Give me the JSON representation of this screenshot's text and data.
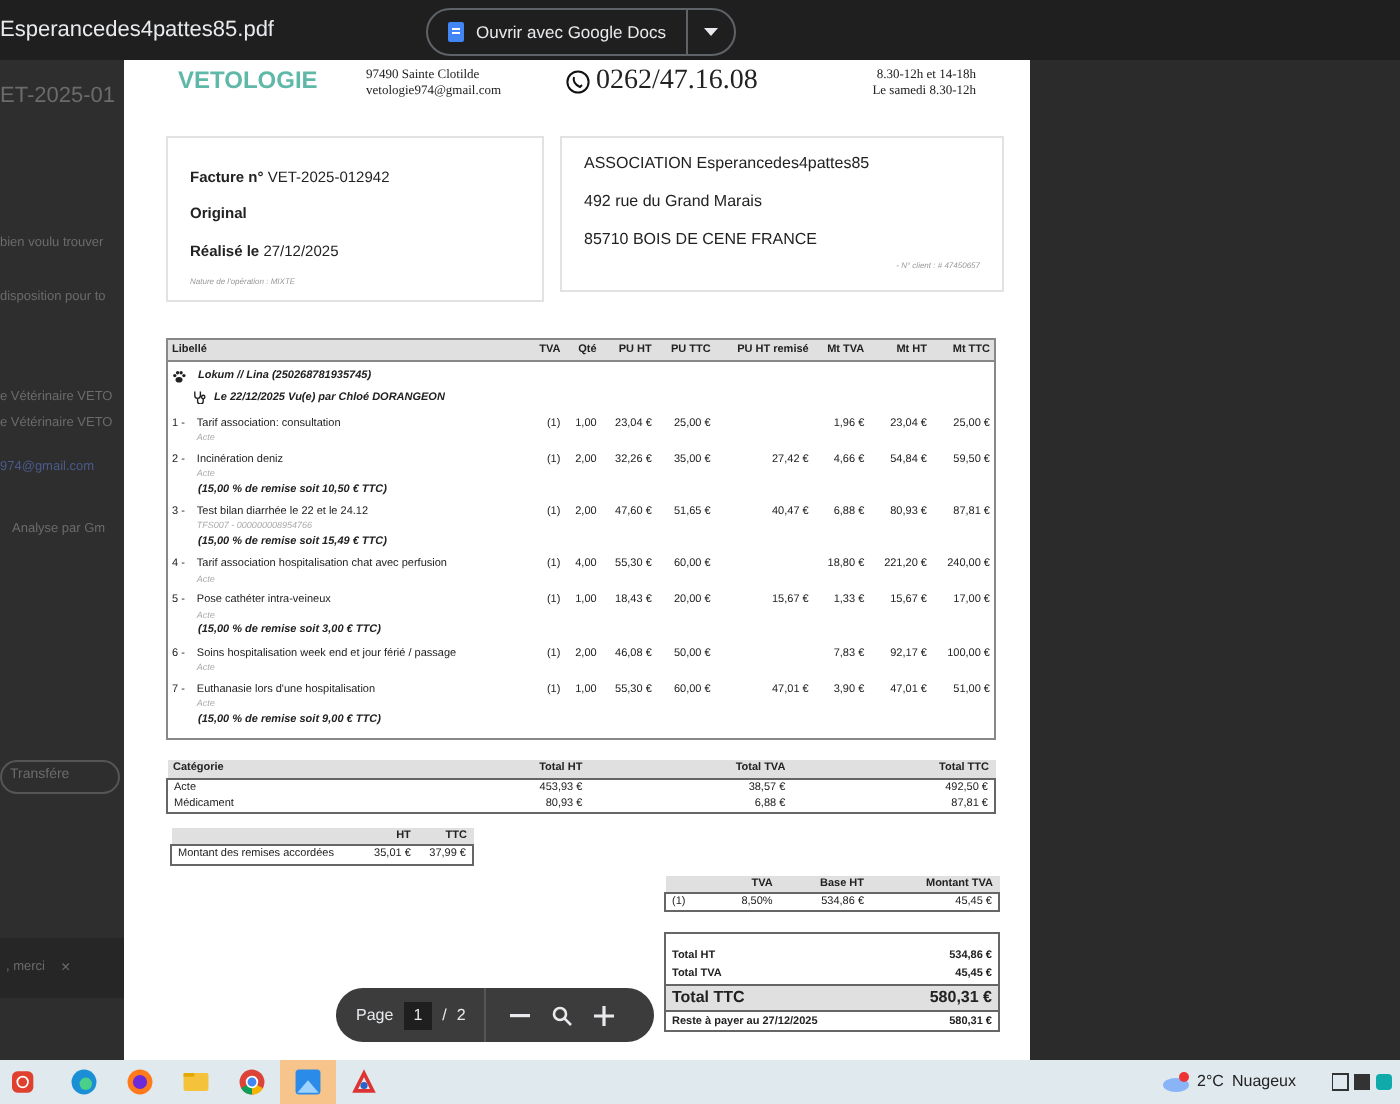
{
  "viewer": {
    "file_name": "Esperancedes4pattes85.pdf",
    "open_button": "Ouvrir avec Google Docs"
  },
  "background_mail": {
    "subject": "ET-2025-01",
    "lines": [
      "bien voulu trouver",
      "disposition pour to",
      "e Vétérinaire VETO",
      "e Vétérinaire VETO"
    ],
    "link": "974@gmail.com",
    "summary": "Analyse par Gm",
    "forward_button": "Transfére",
    "snackbar": ", merci",
    "snackbar_close": "×"
  },
  "invoice": {
    "header": {
      "logo": "VETOLOGIE",
      "address": [
        "97490 Sainte Clotilde",
        "vetologie974@gmail.com"
      ],
      "phone": "0262/47.16.08",
      "hours": [
        "8.30-12h et 14-18h",
        "Le samedi 8.30-12h"
      ]
    },
    "info": {
      "number_label": "Facture n°",
      "number": "VET-2025-012942",
      "copy": "Original",
      "date_label": "Réalisé le",
      "date": "27/12/2025",
      "nature": "Nature de l'opération : MIXTE"
    },
    "client": {
      "lines": [
        "ASSOCIATION Esperancedes4pattes85",
        "492 rue du Grand Marais",
        "85710 BOIS DE CENE FRANCE"
      ],
      "client_number": "- N° client : # 47450657"
    },
    "items": {
      "columns": [
        "Libellé",
        "TVA",
        "Qté",
        "PU HT",
        "PU TTC",
        "PU HT remisé",
        "Mt TVA",
        "Mt HT",
        "Mt TTC"
      ],
      "animal": "Lokum // Lina (250268781935745)",
      "visit": "Le 22/12/2025 Vu(e) par Chloé DORANGEON",
      "rows": [
        {
          "num": "1 -",
          "label": "Tarif association: consultation",
          "sub": "Acte",
          "values": {
            "tva": "(1)",
            "qty": "1,00",
            "pu_ht": "23,04 €",
            "pu_ttc": "25,00 €",
            "mt_tva": "1,96 €",
            "mt_ht": "23,04 €",
            "mt_ttc": "25,00 €"
          }
        },
        {
          "num": "2 -",
          "label": "Incinération deniz",
          "sub": "Acte",
          "values": {
            "tva": "(1)",
            "qty": "2,00",
            "pu_ht": "32,26 €",
            "pu_ttc": "35,00 €",
            "pu_ht_discounted": "27,42 €",
            "mt_tva": "4,66 €",
            "mt_ht": "54,84 €",
            "mt_ttc": "59,50 €"
          },
          "discount": "(15,00 % de remise soit 10,50 € TTC)"
        },
        {
          "num": "3 -",
          "label": "Test bilan diarrhée le 22 et le 24.12",
          "sub": "TFS007 - 000000008954766",
          "values": {
            "tva": "(1)",
            "qty": "2,00",
            "pu_ht": "47,60 €",
            "pu_ttc": "51,65 €",
            "pu_ht_discounted": "40,47 €",
            "mt_tva": "6,88 €",
            "mt_ht": "80,93 €",
            "mt_ttc": "87,81 €"
          },
          "discount": "(15,00 % de remise soit 15,49 € TTC)"
        },
        {
          "num": "4 -",
          "label": "Tarif association hospitalisation chat avec perfusion",
          "sub": "Acte",
          "values": {
            "tva": "(1)",
            "qty": "4,00",
            "pu_ht": "55,30 €",
            "pu_ttc": "60,00 €",
            "mt_tva": "18,80 €",
            "mt_ht": "221,20 €",
            "mt_ttc": "240,00 €"
          }
        },
        {
          "num": "5 -",
          "label": "Pose cathéter intra-veineux",
          "sub": "Acte",
          "values": {
            "tva": "(1)",
            "qty": "1,00",
            "pu_ht": "18,43 €",
            "pu_ttc": "20,00 €",
            "pu_ht_discounted": "15,67 €",
            "mt_tva": "1,33 €",
            "mt_ht": "15,67 €",
            "mt_ttc": "17,00 €"
          },
          "discount": "(15,00 % de remise soit 3,00 € TTC)"
        },
        {
          "num": "6 -",
          "label": "Soins hospitalisation week end et jour férié / passage",
          "sub": "Acte",
          "values": {
            "tva": "(1)",
            "qty": "2,00",
            "pu_ht": "46,08 €",
            "pu_ttc": "50,00 €",
            "mt_tva": "7,83 €",
            "mt_ht": "92,17 €",
            "mt_ttc": "100,00 €"
          }
        },
        {
          "num": "7 -",
          "label": "Euthanasie lors d'une hospitalisation",
          "sub": "Acte",
          "values": {
            "tva": "(1)",
            "qty": "1,00",
            "pu_ht": "55,30 €",
            "pu_ttc": "60,00 €",
            "pu_ht_discounted": "47,01 €",
            "mt_tva": "3,90 €",
            "mt_ht": "47,01 €",
            "mt_ttc": "51,00 €"
          },
          "discount": "(15,00 % de remise soit 9,00 € TTC)"
        }
      ]
    },
    "categories": {
      "columns": [
        "Catégorie",
        "Total HT",
        "Total TVA",
        "Total TTC"
      ],
      "rows": [
        [
          "Acte",
          "453,93 €",
          "38,57 €",
          "492,50 €"
        ],
        [
          "Médicament",
          "80,93 €",
          "6,88 €",
          "87,81 €"
        ]
      ]
    },
    "discounts": {
      "columns": [
        "",
        "HT",
        "TTC"
      ],
      "rows": [
        [
          "Montant des remises accordées",
          "35,01 €",
          "37,99 €"
        ]
      ]
    },
    "vat": {
      "columns": [
        "",
        "TVA",
        "Base HT",
        "Montant TVA"
      ],
      "rows": [
        [
          "(1)",
          "8,50%",
          "534,86 €",
          "45,45 €"
        ]
      ]
    },
    "totals": [
      {
        "label": "Total HT",
        "value": "534,86 €",
        "kind": "plain"
      },
      {
        "label": "Total TVA",
        "value": "45,45 €",
        "kind": "plain"
      },
      {
        "label": "Total TTC",
        "value": "580,31 €",
        "kind": "grand"
      },
      {
        "label": "Reste à payer au 27/12/2025",
        "value": "580,31 €",
        "kind": "due"
      }
    ]
  },
  "page_toolbar": {
    "label": "Page",
    "current": "1",
    "separator": "/",
    "total": "2"
  },
  "taskbar": {
    "apps": [
      {
        "kind": "power",
        "selected": false
      },
      {
        "kind": "edge",
        "selected": false
      },
      {
        "kind": "firefox",
        "selected": false
      },
      {
        "kind": "folder",
        "selected": false
      },
      {
        "kind": "chrome",
        "selected": false
      },
      {
        "kind": "photos",
        "selected": true
      },
      {
        "kind": "paint",
        "selected": false
      }
    ],
    "weather": {
      "temperature": "2°C",
      "condition": "Nuageux"
    }
  }
}
